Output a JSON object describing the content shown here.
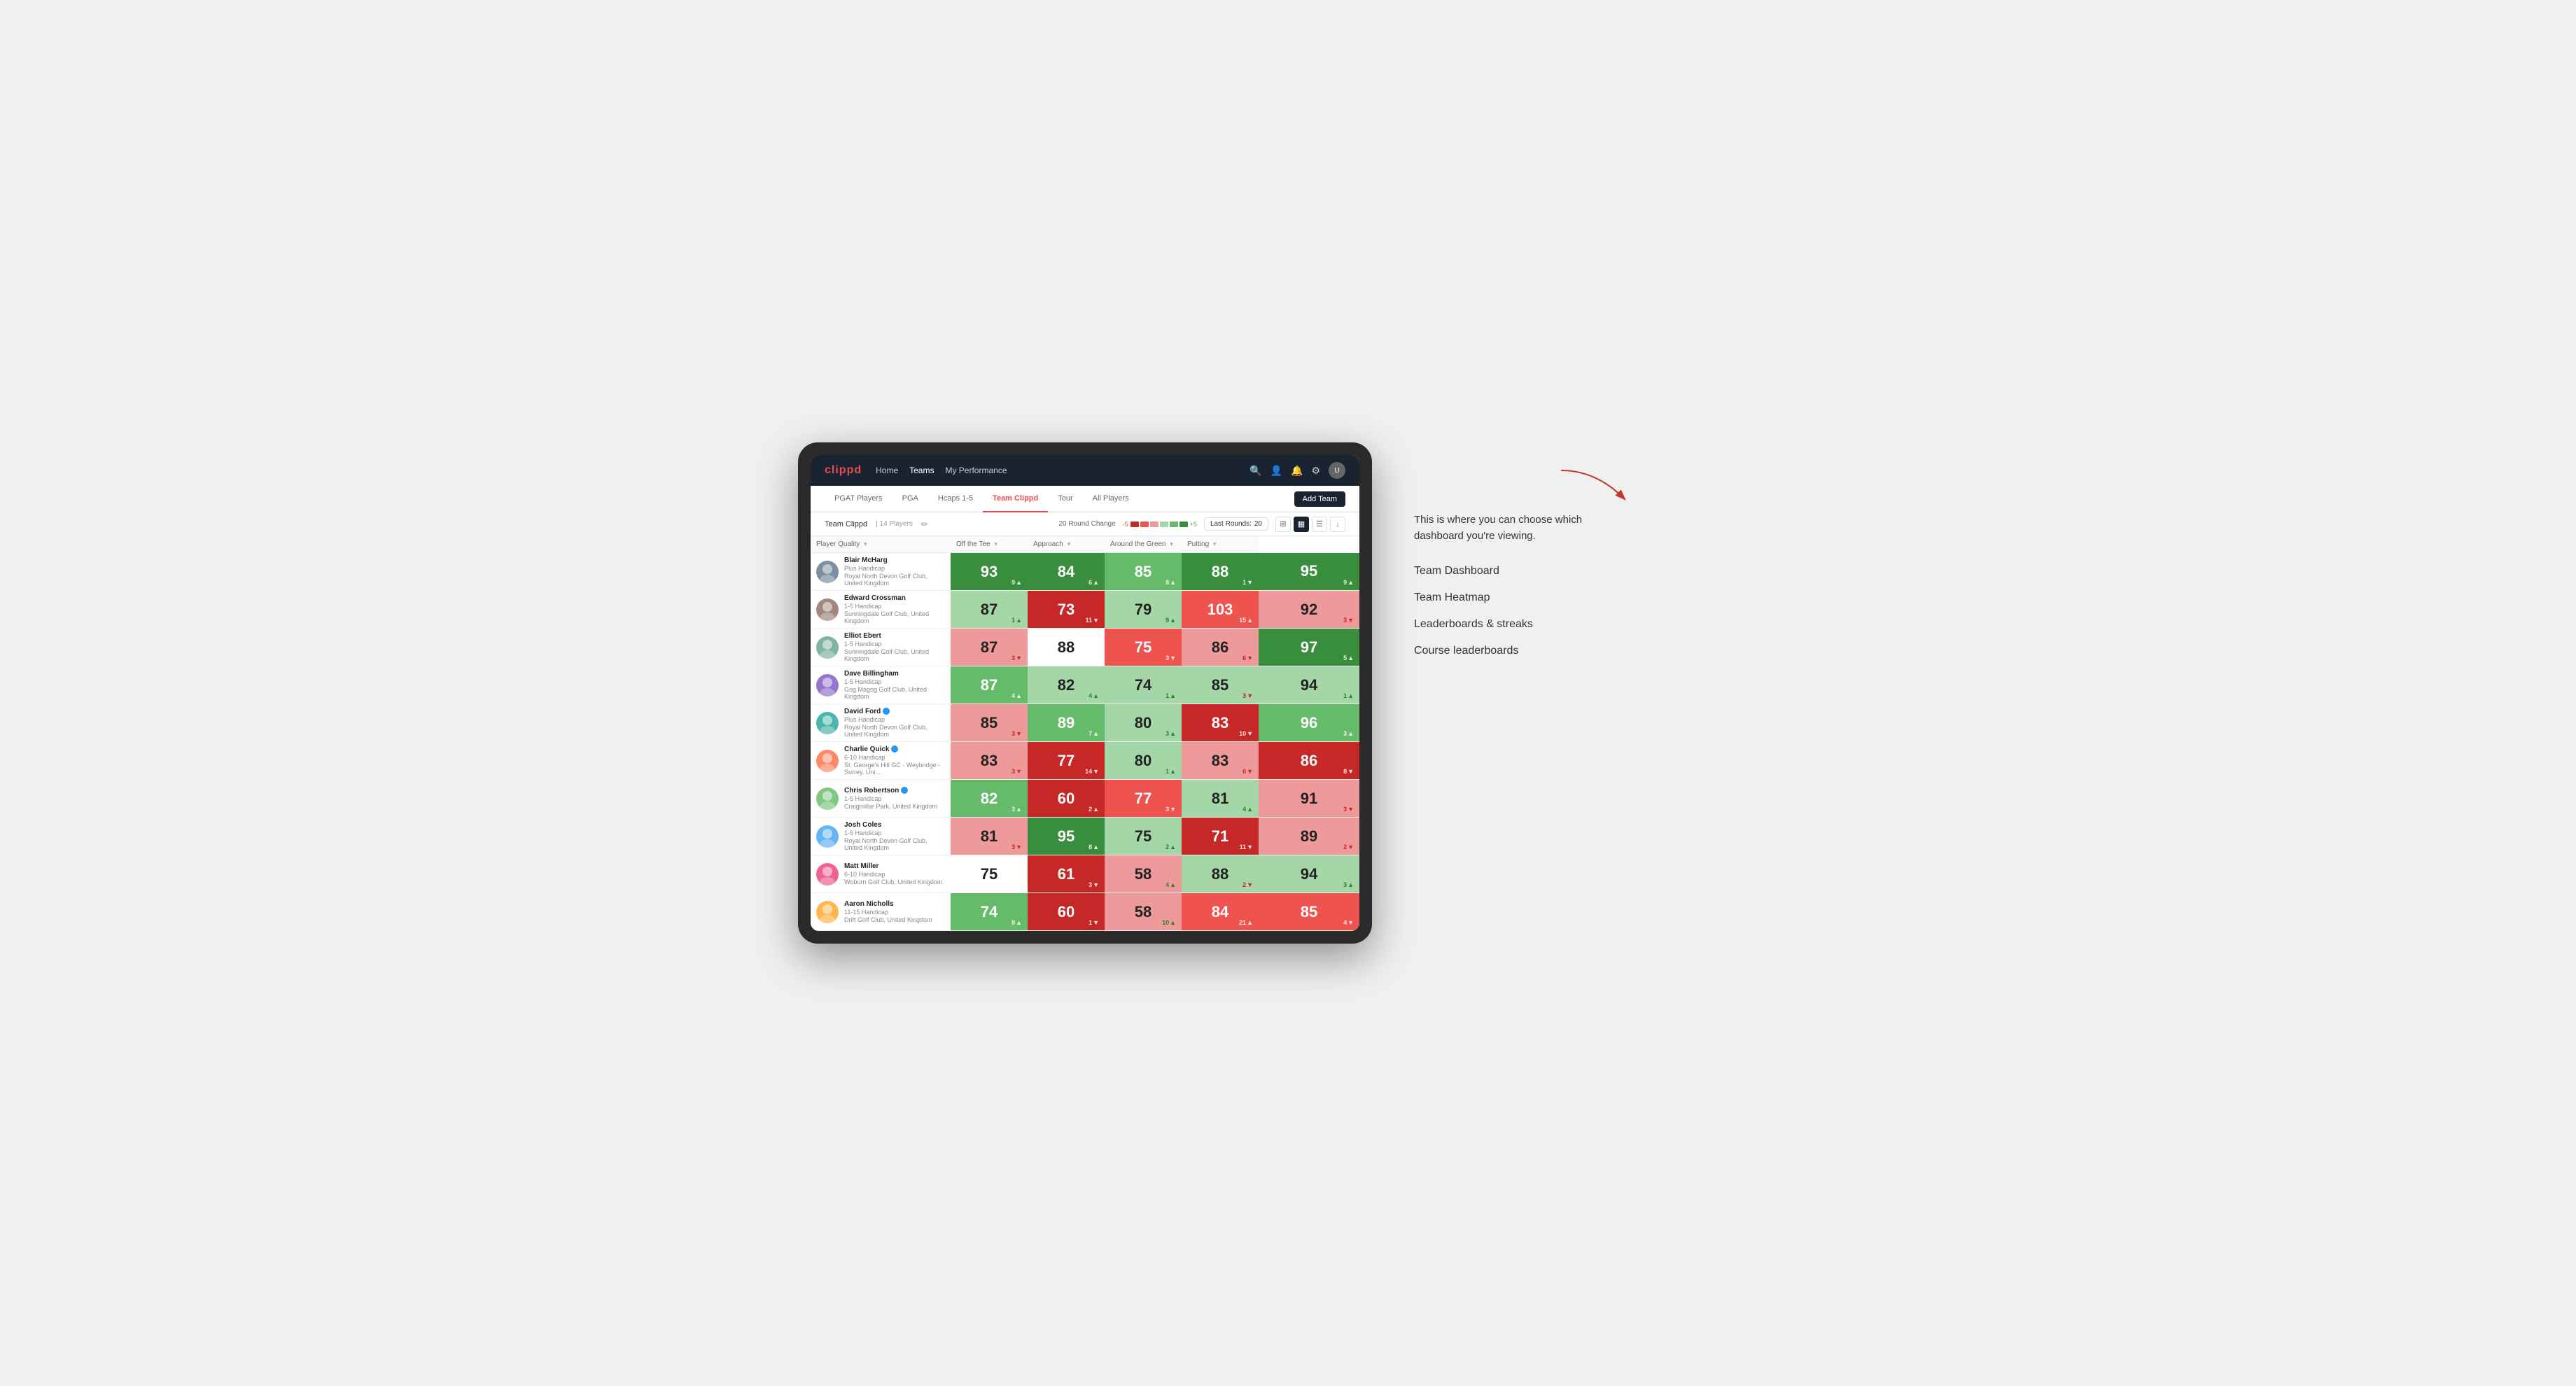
{
  "annotation": {
    "intro_text": "This is where you can choose which dashboard you're viewing.",
    "items": [
      "Team Dashboard",
      "Team Heatmap",
      "Leaderboards & streaks",
      "Course leaderboards"
    ]
  },
  "nav": {
    "logo": "clippd",
    "links": [
      "Home",
      "Teams",
      "My Performance"
    ],
    "active_link": "Teams"
  },
  "second_nav": {
    "links": [
      "PGAT Players",
      "PGA",
      "Hcaps 1-5",
      "Team Clippd",
      "Tour",
      "All Players"
    ],
    "active_link": "Team Clippd",
    "add_team_btn": "Add Team"
  },
  "team_bar": {
    "name": "Team Clippd",
    "separator": "|",
    "count": "14 Players",
    "round_change_label": "20 Round Change",
    "change_neg": "-5",
    "change_pos": "+5",
    "last_rounds_label": "Last Rounds:",
    "last_rounds_value": "20"
  },
  "table": {
    "headers": {
      "player_quality": "Player Quality",
      "off_tee": "Off the Tee",
      "approach": "Approach",
      "around_green": "Around the Green",
      "putting": "Putting"
    },
    "players": [
      {
        "name": "Blair McHarg",
        "handicap": "Plus Handicap",
        "club": "Royal North Devon Golf Club, United Kingdom",
        "pq": {
          "value": "93",
          "change": "9",
          "dir": "up",
          "bg": "green-dark"
        },
        "ott": {
          "value": "84",
          "change": "6",
          "dir": "up",
          "bg": "green-dark"
        },
        "app": {
          "value": "85",
          "change": "8",
          "dir": "up",
          "bg": "green-mid"
        },
        "atg": {
          "value": "88",
          "change": "1",
          "dir": "down",
          "bg": "green-dark"
        },
        "put": {
          "value": "95",
          "change": "9",
          "dir": "up",
          "bg": "green-dark"
        }
      },
      {
        "name": "Edward Crossman",
        "handicap": "1-5 Handicap",
        "club": "Sunningdale Golf Club, United Kingdom",
        "pq": {
          "value": "87",
          "change": "1",
          "dir": "up",
          "bg": "green-light"
        },
        "ott": {
          "value": "73",
          "change": "11",
          "dir": "down",
          "bg": "red-dark"
        },
        "app": {
          "value": "79",
          "change": "9",
          "dir": "up",
          "bg": "green-light"
        },
        "atg": {
          "value": "103",
          "change": "15",
          "dir": "up",
          "bg": "red-mid"
        },
        "put": {
          "value": "92",
          "change": "3",
          "dir": "down",
          "bg": "red-light"
        }
      },
      {
        "name": "Elliot Ebert",
        "handicap": "1-5 Handicap",
        "club": "Sunningdale Golf Club, United Kingdom",
        "pq": {
          "value": "87",
          "change": "3",
          "dir": "down",
          "bg": "red-light"
        },
        "ott": {
          "value": "88",
          "change": "",
          "dir": "",
          "bg": "white"
        },
        "app": {
          "value": "75",
          "change": "3",
          "dir": "down",
          "bg": "red-mid"
        },
        "atg": {
          "value": "86",
          "change": "6",
          "dir": "down",
          "bg": "red-light"
        },
        "put": {
          "value": "97",
          "change": "5",
          "dir": "up",
          "bg": "green-dark"
        }
      },
      {
        "name": "Dave Billingham",
        "handicap": "1-5 Handicap",
        "club": "Gog Magog Golf Club, United Kingdom",
        "pq": {
          "value": "87",
          "change": "4",
          "dir": "up",
          "bg": "green-mid"
        },
        "ott": {
          "value": "82",
          "change": "4",
          "dir": "up",
          "bg": "green-light"
        },
        "app": {
          "value": "74",
          "change": "1",
          "dir": "up",
          "bg": "green-light"
        },
        "atg": {
          "value": "85",
          "change": "3",
          "dir": "down",
          "bg": "green-light"
        },
        "put": {
          "value": "94",
          "change": "1",
          "dir": "up",
          "bg": "green-light"
        }
      },
      {
        "name": "David Ford",
        "handicap": "Plus Handicap",
        "club": "Royal North Devon Golf Club, United Kingdom",
        "verified": true,
        "pq": {
          "value": "85",
          "change": "3",
          "dir": "down",
          "bg": "red-light"
        },
        "ott": {
          "value": "89",
          "change": "7",
          "dir": "up",
          "bg": "green-mid"
        },
        "app": {
          "value": "80",
          "change": "3",
          "dir": "up",
          "bg": "green-light"
        },
        "atg": {
          "value": "83",
          "change": "10",
          "dir": "down",
          "bg": "red-dark"
        },
        "put": {
          "value": "96",
          "change": "3",
          "dir": "up",
          "bg": "green-mid"
        }
      },
      {
        "name": "Charlie Quick",
        "handicap": "6-10 Handicap",
        "club": "St. George's Hill GC - Weybridge - Surrey, Uni...",
        "verified": true,
        "pq": {
          "value": "83",
          "change": "3",
          "dir": "down",
          "bg": "red-light"
        },
        "ott": {
          "value": "77",
          "change": "14",
          "dir": "down",
          "bg": "red-dark"
        },
        "app": {
          "value": "80",
          "change": "1",
          "dir": "up",
          "bg": "green-light"
        },
        "atg": {
          "value": "83",
          "change": "6",
          "dir": "down",
          "bg": "red-light"
        },
        "put": {
          "value": "86",
          "change": "8",
          "dir": "down",
          "bg": "red-dark"
        }
      },
      {
        "name": "Chris Robertson",
        "handicap": "1-5 Handicap",
        "club": "Craigmillar Park, United Kingdom",
        "verified": true,
        "pq": {
          "value": "82",
          "change": "3",
          "dir": "up",
          "bg": "green-mid"
        },
        "ott": {
          "value": "60",
          "change": "2",
          "dir": "up",
          "bg": "red-dark"
        },
        "app": {
          "value": "77",
          "change": "3",
          "dir": "down",
          "bg": "red-mid"
        },
        "atg": {
          "value": "81",
          "change": "4",
          "dir": "up",
          "bg": "green-light"
        },
        "put": {
          "value": "91",
          "change": "3",
          "dir": "down",
          "bg": "red-light"
        }
      },
      {
        "name": "Josh Coles",
        "handicap": "1-5 Handicap",
        "club": "Royal North Devon Golf Club, United Kingdom",
        "pq": {
          "value": "81",
          "change": "3",
          "dir": "down",
          "bg": "red-light"
        },
        "ott": {
          "value": "95",
          "change": "8",
          "dir": "up",
          "bg": "green-dark"
        },
        "app": {
          "value": "75",
          "change": "2",
          "dir": "up",
          "bg": "green-light"
        },
        "atg": {
          "value": "71",
          "change": "11",
          "dir": "down",
          "bg": "red-dark"
        },
        "put": {
          "value": "89",
          "change": "2",
          "dir": "down",
          "bg": "red-light"
        }
      },
      {
        "name": "Matt Miller",
        "handicap": "6-10 Handicap",
        "club": "Woburn Golf Club, United Kingdom",
        "pq": {
          "value": "75",
          "change": "",
          "dir": "",
          "bg": "white"
        },
        "ott": {
          "value": "61",
          "change": "3",
          "dir": "down",
          "bg": "red-dark"
        },
        "app": {
          "value": "58",
          "change": "4",
          "dir": "up",
          "bg": "red-light"
        },
        "atg": {
          "value": "88",
          "change": "2",
          "dir": "down",
          "bg": "green-light"
        },
        "put": {
          "value": "94",
          "change": "3",
          "dir": "up",
          "bg": "green-light"
        }
      },
      {
        "name": "Aaron Nicholls",
        "handicap": "11-15 Handicap",
        "club": "Drift Golf Club, United Kingdom",
        "pq": {
          "value": "74",
          "change": "8",
          "dir": "up",
          "bg": "green-mid"
        },
        "ott": {
          "value": "60",
          "change": "1",
          "dir": "down",
          "bg": "red-dark"
        },
        "app": {
          "value": "58",
          "change": "10",
          "dir": "up",
          "bg": "red-light"
        },
        "atg": {
          "value": "84",
          "change": "21",
          "dir": "up",
          "bg": "red-mid"
        },
        "put": {
          "value": "85",
          "change": "4",
          "dir": "down",
          "bg": "red-mid"
        }
      }
    ]
  }
}
